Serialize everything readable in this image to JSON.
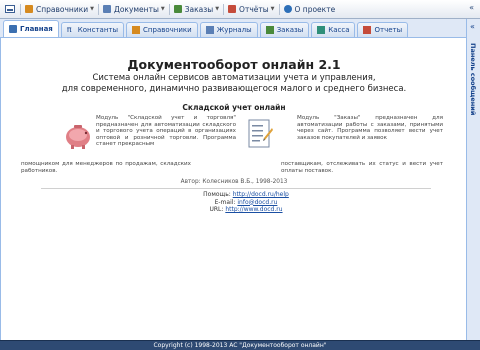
{
  "menubar": {
    "items": [
      {
        "label": "Справочники",
        "icon": "book-icon",
        "color": "#d68a1f",
        "dropdown": true
      },
      {
        "label": "Документы",
        "icon": "document-icon",
        "color": "#5a7fb5",
        "dropdown": true
      },
      {
        "label": "Заказы",
        "icon": "cart-icon",
        "color": "#4a8a3a",
        "dropdown": true
      },
      {
        "label": "Отчёты",
        "icon": "report-icon",
        "color": "#c54b3a",
        "dropdown": true
      },
      {
        "label": "О проекте",
        "icon": "info-icon",
        "color": "#2d6fb8",
        "dropdown": false
      }
    ]
  },
  "tabs": [
    {
      "label": "Главная",
      "icon": "home-icon",
      "active": true
    },
    {
      "label": "Константы",
      "icon": "pi-icon",
      "active": false
    },
    {
      "label": "Справочники",
      "icon": "book-icon",
      "active": false
    },
    {
      "label": "Журналы",
      "icon": "journal-icon",
      "active": false
    },
    {
      "label": "Заказы",
      "icon": "cart-icon",
      "active": false
    },
    {
      "label": "Касса",
      "icon": "cash-icon",
      "active": false
    },
    {
      "label": "Отчеты",
      "icon": "report-icon",
      "active": false
    }
  ],
  "sidepanel": {
    "label": "Панель сообщений",
    "toggle": "«"
  },
  "main": {
    "title": "Документооборот онлайн 2.1",
    "subtitle_line1": "Система онлайн сервисов автоматизации учета и управления,",
    "subtitle_line2": "для современного, динамично развивающегося малого и среднего бизнеса.",
    "section_title": "Складской учет онлайн",
    "module1_a": "Модуль \"Складской учет и торговля\" предназначен для автоматизации складского и торгового учета операций в организациях оптовой и розничной торговли. Программа станет прекрасным",
    "module1_b": "помощником для менеджеров по продажам, складских работников.",
    "module2_a": "Модуль \"Заказы\" предназначен для автоматизации работы с заказами, принятыми через сайт. Программа позволяет вести учет заказов покупателей и заявок",
    "module2_b": "поставщикам, отслеживать их статус и вести учет оплаты поставок.",
    "author": "Автор: Колесников В.Б., 1998-2013",
    "contacts": {
      "help_label": "Помощь:",
      "help_url": "http://docd.ru/help",
      "email_label": "E-mail:",
      "email": "info@docd.ru",
      "url_label": "URL:",
      "url": "http://www.docd.ru"
    }
  },
  "statusbar": {
    "text": "Copyright (c) 1998-2013 AC \"Документооборот онлайн\""
  },
  "colors": {
    "accent": "#15428b",
    "tab_bg": "#dfe8f6",
    "border": "#99bbe8",
    "statusbar": "#2e4a73"
  }
}
